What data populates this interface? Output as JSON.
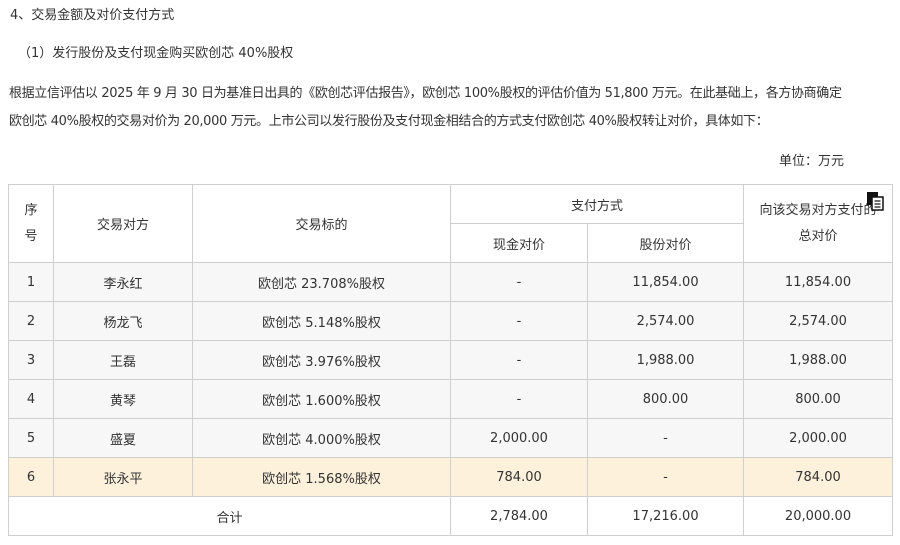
{
  "heading": "4、交易金额及对价支付方式",
  "subheading": "（1）发行股份及支付现金购买欧创芯 40%股权",
  "paragraph": {
    "line1": "根据立信评估以 2025 年 9 月 30 日为基准日出具的《欧创芯评估报告》，欧创芯 100%股权的评估价值为 51,800 万元。在此基础上，各方协商确定",
    "line2": "欧创芯 40%股权的交易对价为 20,000 万元。上市公司以发行股份及支付现金相结合的方式支付欧创芯 40%股权转让对价，具体如下："
  },
  "unit": "单位：万元",
  "table": {
    "headers": {
      "seq_line1": "序",
      "seq_line2": "号",
      "counterparty": "交易对方",
      "target": "交易标的",
      "payment_method": "支付方式",
      "cash": "现金对价",
      "share": "股份对价",
      "total_line1": "向该交易对方支付的",
      "total_line2": "总对价"
    },
    "rows": [
      {
        "seq": "1",
        "name": "李永红",
        "target": "欧创芯 23.708%股权",
        "cash": "-",
        "share": "11,854.00",
        "total": "11,854.00"
      },
      {
        "seq": "2",
        "name": "杨龙飞",
        "target": "欧创芯 5.148%股权",
        "cash": "-",
        "share": "2,574.00",
        "total": "2,574.00"
      },
      {
        "seq": "3",
        "name": "王磊",
        "target": "欧创芯 3.976%股权",
        "cash": "-",
        "share": "1,988.00",
        "total": "1,988.00"
      },
      {
        "seq": "4",
        "name": "黄琴",
        "target": "欧创芯 1.600%股权",
        "cash": "-",
        "share": "800.00",
        "total": "800.00"
      },
      {
        "seq": "5",
        "name": "盛夏",
        "target": "欧创芯 4.000%股权",
        "cash": "2,000.00",
        "share": "-",
        "total": "2,000.00"
      },
      {
        "seq": "6",
        "name": "张永平",
        "target": "欧创芯 1.568%股权",
        "cash": "784.00",
        "share": "-",
        "total": "784.00"
      }
    ],
    "totals": {
      "label": "合计",
      "cash": "2,784.00",
      "share": "17,216.00",
      "total": "20,000.00"
    }
  },
  "icons": {
    "copy": "copy-icon"
  },
  "colors": {
    "highlight_row": "#fdf1dc",
    "row_bg": "#f7f7f7",
    "border": "#cfcfcf",
    "text": "#333333"
  }
}
